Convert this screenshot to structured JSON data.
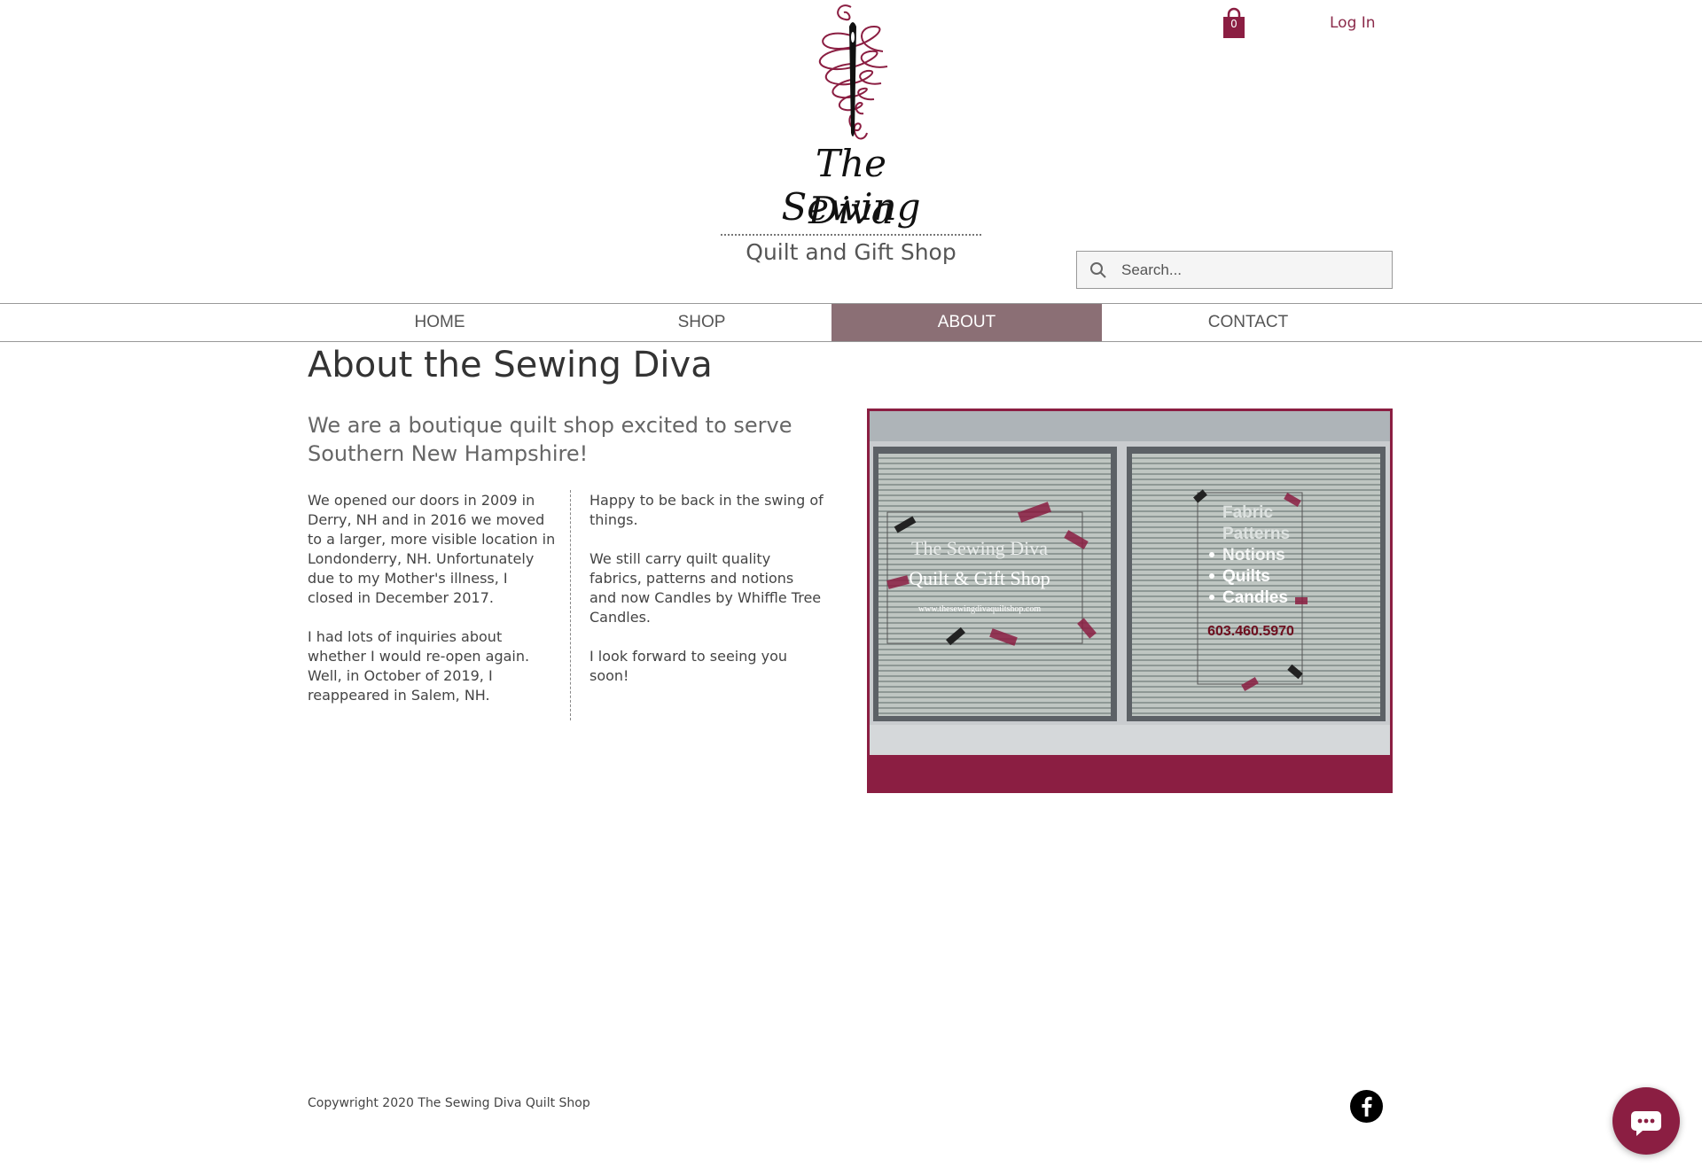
{
  "header": {
    "logo_line1": "The Sewing",
    "logo_line2": "Diva",
    "tagline": "Quilt and Gift Shop",
    "cart_count": "0",
    "login_label": "Log In",
    "search_placeholder": "Search..."
  },
  "nav": {
    "items": [
      {
        "label": "HOME"
      },
      {
        "label": "SHOP"
      },
      {
        "label": "ABOUT",
        "active": true
      },
      {
        "label": "CONTACT"
      }
    ]
  },
  "main": {
    "title": "About the Sewing Diva",
    "subheading": "We are a boutique quilt shop excited to serve Southern New Hampshire!",
    "col1": [
      "We opened our doors in 2009 in Derry, NH and in 2016 we moved to a larger, more visible location in Londonderry, NH. Unfortunately due to my Mother's illness, I closed in December 2017.",
      "I had lots of inquiries about whether I would re-open again. Well, in October of 2019, I reappeared in Salem, NH."
    ],
    "col2": [
      "Happy to be back in the swing of things.",
      "We still carry quilt quality fabrics, patterns and notions and now Candles by Whiffle Tree Candles.",
      "I look forward to seeing you soon!"
    ],
    "storefront": {
      "sign_title": "The Sewing Diva",
      "sign_subtitle": "Quilt & Gift Shop",
      "sign_url": "www.thesewingdivaquiltshop.com",
      "list": [
        "Fabric",
        "Patterns",
        "Notions",
        "Quilts",
        "Candles"
      ],
      "phone": "603.460.5970"
    }
  },
  "footer": {
    "copyright": "Copywright 2020 The Sewing Diva Quilt Shop"
  },
  "colors": {
    "brand": "#8b1e42",
    "nav_active": "#8b6f75"
  }
}
